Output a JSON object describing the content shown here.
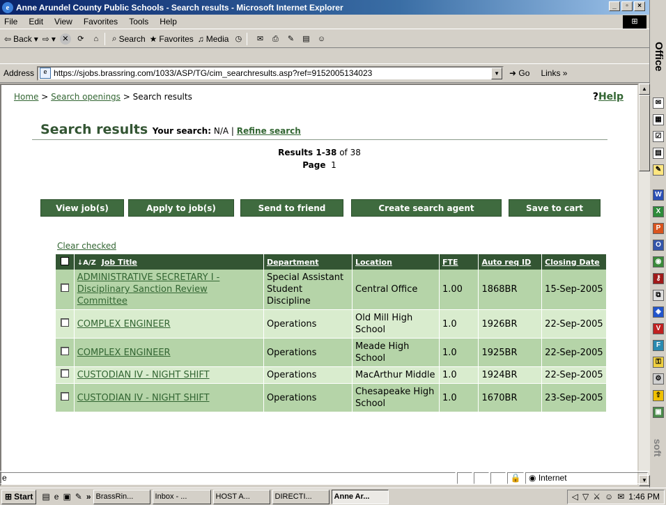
{
  "window": {
    "title": "Anne Arundel County Public Schools - Search results - Microsoft Internet Explorer",
    "min_label": "_",
    "max_label": "▫",
    "close_label": "×"
  },
  "menu": [
    "File",
    "Edit",
    "View",
    "Favorites",
    "Tools",
    "Help"
  ],
  "toolbar": {
    "back": "Back",
    "search": "Search",
    "favorites": "Favorites",
    "media": "Media"
  },
  "address": {
    "label": "Address",
    "url": "https://sjobs.brassring.com/1033/ASP/TG/cim_searchresults.asp?ref=9152005134023",
    "go": "Go",
    "links": "Links"
  },
  "office_bar": {
    "label": "Office",
    "bottom": "soft"
  },
  "breadcrumb": {
    "home": "Home",
    "sep1": " > ",
    "search": "Search openings",
    "sep2": " > ",
    "current": "Search results"
  },
  "help": {
    "q": "?",
    "label": "Help"
  },
  "heading": {
    "title": "Search results",
    "your_search_label": "Your search:",
    "your_search_value": " N/A | ",
    "refine": "Refine search"
  },
  "results": {
    "range_label": "Results 1-38",
    "of": " of 38",
    "page_label": "Page",
    "page_value": "1"
  },
  "buttons": {
    "view": "View job(s)",
    "apply": "Apply to job(s)",
    "send": "Send to friend",
    "agent": "Create search agent",
    "cart": "Save to cart"
  },
  "clear_checked": "Clear checked",
  "table": {
    "sort_icon": "↓A/Z",
    "columns": [
      "Job Title",
      "Department",
      "Location",
      "FTE",
      "Auto req ID",
      "Closing Date"
    ],
    "rows": [
      {
        "title": "ADMINISTRATIVE SECRETARY I - Disciplinary Sanction Review Committee",
        "dept": "Special Assistant Student Discipline",
        "location": "Central Office",
        "fte": "1.00",
        "req": "1868BR",
        "closing": "15-Sep-2005"
      },
      {
        "title": "COMPLEX ENGINEER",
        "dept": "Operations",
        "location": "Old Mill High School",
        "fte": "1.0",
        "req": "1926BR",
        "closing": "22-Sep-2005"
      },
      {
        "title": "COMPLEX ENGINEER",
        "dept": "Operations",
        "location": "Meade High School",
        "fte": "1.0",
        "req": "1925BR",
        "closing": "22-Sep-2005"
      },
      {
        "title": "CUSTODIAN IV - NIGHT SHIFT",
        "dept": "Operations",
        "location": "MacArthur Middle",
        "fte": "1.0",
        "req": "1924BR",
        "closing": "22-Sep-2005"
      },
      {
        "title": "CUSTODIAN IV - NIGHT SHIFT",
        "dept": "Operations",
        "location": "Chesapeake High School",
        "fte": "1.0",
        "req": "1670BR",
        "closing": "23-Sep-2005"
      }
    ]
  },
  "status": {
    "zone": "Internet"
  },
  "taskbar": {
    "start": "Start",
    "chevron": "»",
    "tasks": [
      "BrassRin...",
      "Inbox - ...",
      "HOST A...",
      "DIRECTI...",
      "Anne Ar..."
    ],
    "clock": "1:46 PM"
  }
}
